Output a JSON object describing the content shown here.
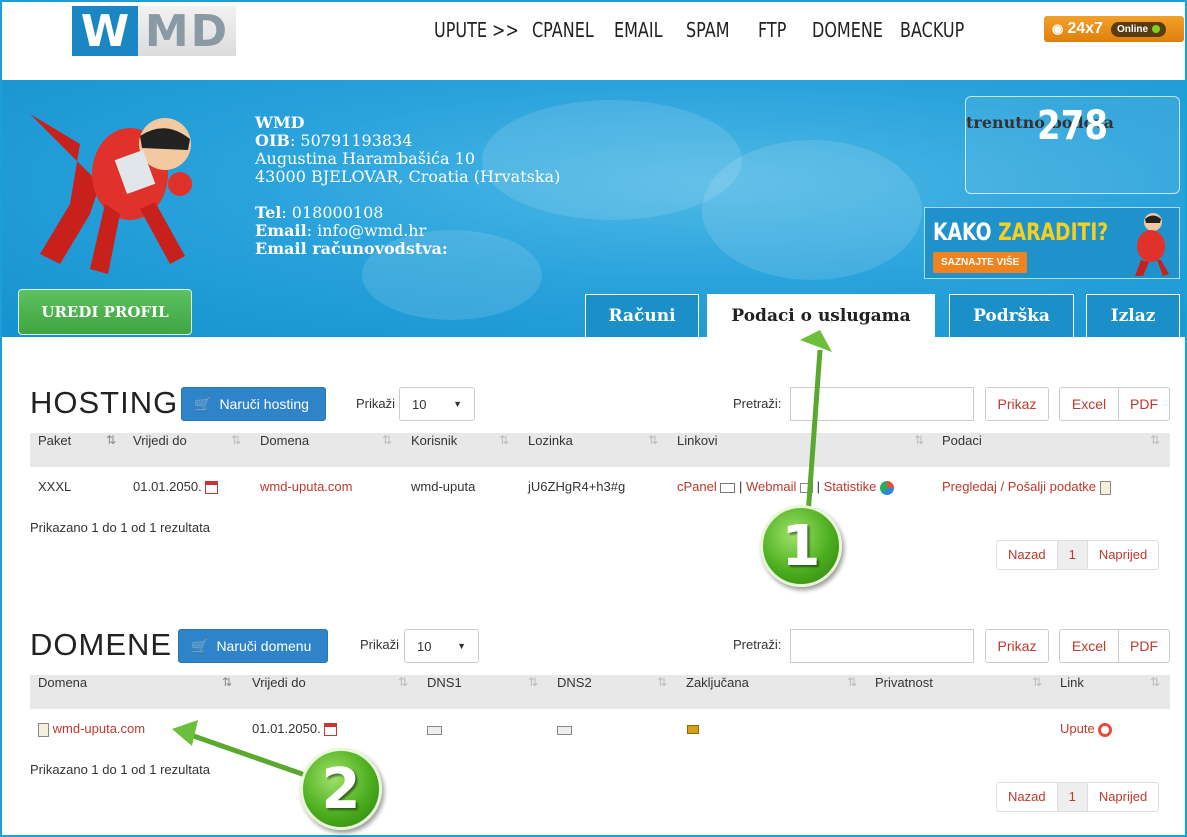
{
  "logo": {
    "w": "W",
    "md": "MD"
  },
  "nav": [
    "UPUTE >>",
    "CPANEL",
    "EMAIL",
    "SPAM",
    "FTP",
    "DOMENE",
    "BACKUP"
  ],
  "chat": {
    "label": "24x7",
    "status": "Online",
    "colors": {
      "accent": "#e8890f"
    }
  },
  "company": {
    "name": "WMD",
    "oib_label": "OIB",
    "oib": ": 50791193834",
    "address1": "Augustina Harambašića 10",
    "address2": "43000 BJELOVAR, Croatia (Hrvatska)",
    "tel_label": "Tel",
    "tel": ": 018000108",
    "email_label": "Email",
    "email": ": info@wmd.hr",
    "acc_email_label": "Email računovodstva:"
  },
  "points": {
    "label": "trenutno bodova",
    "value": "278"
  },
  "promo": {
    "kako": "KAKO ",
    "zaraditi": "ZARADITI?",
    "button": "SAZNAJTE VIŠE"
  },
  "edit_profile": "UREDI PROFIL",
  "tabs": [
    "Računi",
    "Podaci o uslugama",
    "Podrška",
    "Izlaz"
  ],
  "hosting": {
    "title": "HOSTING",
    "order": "Naruči hosting",
    "show_label": "Prikaži",
    "show_value": "10",
    "search_label": "Pretraži:",
    "search_btn": "Prikaz",
    "excel": "Excel",
    "pdf": "PDF",
    "columns": [
      "Paket",
      "Vrijedi do",
      "Domena",
      "Korisnik",
      "Lozinka",
      "Linkovi",
      "Podaci"
    ],
    "row": {
      "paket": "XXXL",
      "vrijedi": "01.01.2050.",
      "domena": "wmd-uputa.com",
      "korisnik": "wmd-uputa",
      "lozinka": "jU6ZHgR4+h3#g",
      "cpanel": "cPanel",
      "sep": "|",
      "webmail": "Webmail",
      "statistike": "Statistike",
      "podaci": "Pregledaj / Pošalji podatke"
    },
    "info": "Prikazano 1 do 1 od 1 rezultata",
    "pager": [
      "Nazad",
      "1",
      "Naprijed"
    ]
  },
  "domene": {
    "title": "DOMENE",
    "order": "Naruči domenu",
    "show_label": "Prikaži",
    "show_value": "10",
    "search_label": "Pretraži:",
    "search_btn": "Prikaz",
    "excel": "Excel",
    "pdf": "PDF",
    "columns": [
      "Domena",
      "Vrijedi do",
      "DNS1",
      "DNS2",
      "Zaključana",
      "Privatnost",
      "Link"
    ],
    "row": {
      "domena": "wmd-uputa.com",
      "vrijedi": "01.01.2050.",
      "link": "Upute"
    },
    "info": "Prikazano 1 do 1 od 1 rezultata",
    "pager": [
      "Nazad",
      "1",
      "Naprijed"
    ]
  },
  "annotations": {
    "one": "1",
    "two": "2"
  },
  "colors": {
    "banner": "#2aa3dc",
    "link": "#c0392b",
    "button_blue": "#2f84c9",
    "green": "#4cae1e"
  }
}
